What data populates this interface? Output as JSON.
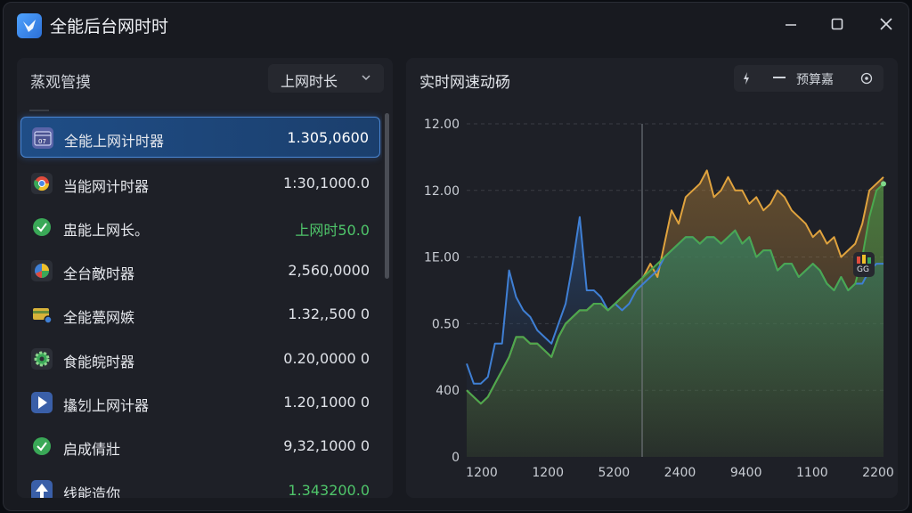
{
  "window": {
    "title": "全能后台网时时"
  },
  "list_panel": {
    "title": "蒸观管摸",
    "select_value": "上网时长",
    "items": [
      {
        "label": "全能上网计时器",
        "value": "1.305,0600",
        "icon": "calendar-icon",
        "selected": true
      },
      {
        "label": "当能网计时器",
        "value": "1:30,1000.0",
        "icon": "chrome-icon"
      },
      {
        "label": "盅能上网长。",
        "value": "上网时50.0",
        "icon": "check-circle-icon",
        "value_color": "#4fc56a"
      },
      {
        "label": "全台敵时器",
        "value": "2,560,0000",
        "icon": "pie-icon"
      },
      {
        "label": "全能甍网嫉",
        "value": "1.32,,500 0",
        "icon": "card-icon"
      },
      {
        "label": "食能皖时器",
        "value": "0.20,0000 0",
        "icon": "gear-icon"
      },
      {
        "label": "攭刉上网计器",
        "value": "1.20,1000 0",
        "icon": "play-icon"
      },
      {
        "label": "启成倩壯",
        "value": "9,32,1000 0",
        "icon": "check-circle-icon"
      },
      {
        "label": "线能造你",
        "value": "1.343200.0",
        "icon": "upload-icon",
        "value_color": "#4fc56a",
        "value_tail_white": "0"
      }
    ]
  },
  "chart_panel": {
    "title": "实时网速动砀",
    "tools": {
      "label": "预算嘉",
      "icons": [
        "lightning-icon",
        "minus-icon",
        "target-icon"
      ]
    },
    "marker_badge": "GG"
  },
  "chart_data": {
    "type": "line",
    "title": "实时网速动砀",
    "y_tick_labels": [
      "12.00",
      "12.00",
      "1E.00",
      "0.50",
      "400",
      "0"
    ],
    "x_tick_labels": [
      "1200",
      "1200",
      "5200",
      "2400",
      "9400",
      "1100",
      "2200"
    ],
    "x": [
      0,
      1,
      2,
      3,
      4,
      5,
      6,
      7,
      8,
      9,
      10,
      11,
      12,
      13,
      14,
      15,
      16,
      17,
      18,
      19,
      20,
      21,
      22,
      23,
      24,
      25,
      26,
      27,
      28,
      29,
      30,
      31,
      32,
      33,
      34,
      35,
      36,
      37,
      38,
      39,
      40,
      41,
      42,
      43,
      44,
      45,
      46,
      47,
      48,
      49,
      50,
      51,
      52,
      53,
      54,
      55,
      56,
      57,
      58,
      59
    ],
    "xlim": [
      0,
      59
    ],
    "ylim": [
      0,
      5
    ],
    "grid": "horizontal-dashed",
    "legend": "none",
    "series": [
      {
        "color": "#3f7fd4",
        "values": [
          1.4,
          1.1,
          1.1,
          1.2,
          1.7,
          1.7,
          2.8,
          2.4,
          2.2,
          2.1,
          1.9,
          1.8,
          1.7,
          2.0,
          2.3,
          2.9,
          3.6,
          2.5,
          2.5,
          2.4,
          2.2,
          2.3,
          2.2,
          2.3,
          2.5,
          2.6,
          2.7,
          2.8,
          3.0,
          3.1,
          3.2,
          3.3,
          3.3,
          3.2,
          3.3,
          3.3,
          3.2,
          3.3,
          3.4,
          3.2,
          3.3,
          3.0,
          3.1,
          3.1,
          2.8,
          2.9,
          2.9,
          2.7,
          2.8,
          2.9,
          2.8,
          2.6,
          2.5,
          2.7,
          2.5,
          2.6,
          2.6,
          2.8,
          2.9,
          2.9
        ]
      },
      {
        "color": "#e0a33e",
        "values": [
          1.0,
          0.9,
          0.8,
          0.9,
          1.1,
          1.3,
          1.5,
          1.8,
          1.8,
          1.7,
          1.7,
          1.6,
          1.5,
          1.8,
          2.0,
          2.1,
          2.2,
          2.2,
          2.3,
          2.3,
          2.2,
          2.3,
          2.4,
          2.5,
          2.6,
          2.7,
          2.9,
          2.7,
          3.2,
          3.7,
          3.5,
          3.9,
          4.0,
          4.1,
          4.3,
          3.9,
          4.0,
          4.2,
          4.0,
          4.0,
          3.8,
          3.9,
          3.7,
          3.8,
          4.0,
          3.9,
          3.7,
          3.6,
          3.5,
          3.3,
          3.4,
          3.2,
          3.3,
          3.0,
          3.1,
          3.2,
          3.5,
          4.0,
          4.1,
          4.2
        ]
      },
      {
        "color": "#4aa94f",
        "values": [
          1.0,
          0.9,
          0.8,
          0.9,
          1.1,
          1.3,
          1.5,
          1.8,
          1.8,
          1.7,
          1.7,
          1.6,
          1.5,
          1.8,
          2.0,
          2.1,
          2.2,
          2.2,
          2.3,
          2.3,
          2.2,
          2.3,
          2.4,
          2.5,
          2.6,
          2.7,
          2.8,
          2.9,
          3.0,
          3.1,
          3.2,
          3.3,
          3.3,
          3.2,
          3.3,
          3.3,
          3.2,
          3.3,
          3.4,
          3.2,
          3.3,
          3.0,
          3.1,
          3.1,
          2.8,
          2.9,
          2.9,
          2.7,
          2.8,
          2.9,
          2.8,
          2.6,
          2.5,
          2.7,
          2.5,
          2.6,
          3.0,
          3.6,
          4.0,
          4.1
        ]
      }
    ]
  }
}
